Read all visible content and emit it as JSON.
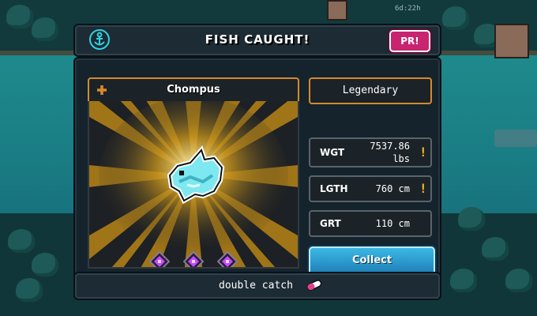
{
  "hud": {
    "timer": "6d:22h"
  },
  "dialog": {
    "title": "FISH CAUGHT!",
    "badge": "PR!",
    "fish": {
      "name": "Chompus",
      "rarity": "Legendary",
      "star_count": 3
    },
    "stats": [
      {
        "label": "WGT",
        "value_line1": "7537.86",
        "value_line2": "lbs",
        "flagged": true
      },
      {
        "label": "LGTH",
        "value": "760 cm",
        "flagged": true
      },
      {
        "label": "GRT",
        "value": "110 cm",
        "flagged": false
      }
    ],
    "alert_glyph": "!",
    "collect_label": "Collect",
    "perk": "double catch"
  },
  "colors": {
    "accent_orange": "#d58a2c",
    "badge_pink": "#c8246f",
    "collect_blue": "#2ea4d8",
    "fish_cyan": "#7ee8f0",
    "star_purple": "#c34bff",
    "alert_yellow": "#f3b61f"
  },
  "icons": [
    "anchor-icon",
    "fish-sprite",
    "rarity-star-icon",
    "alert-icon",
    "pill-icon"
  ]
}
